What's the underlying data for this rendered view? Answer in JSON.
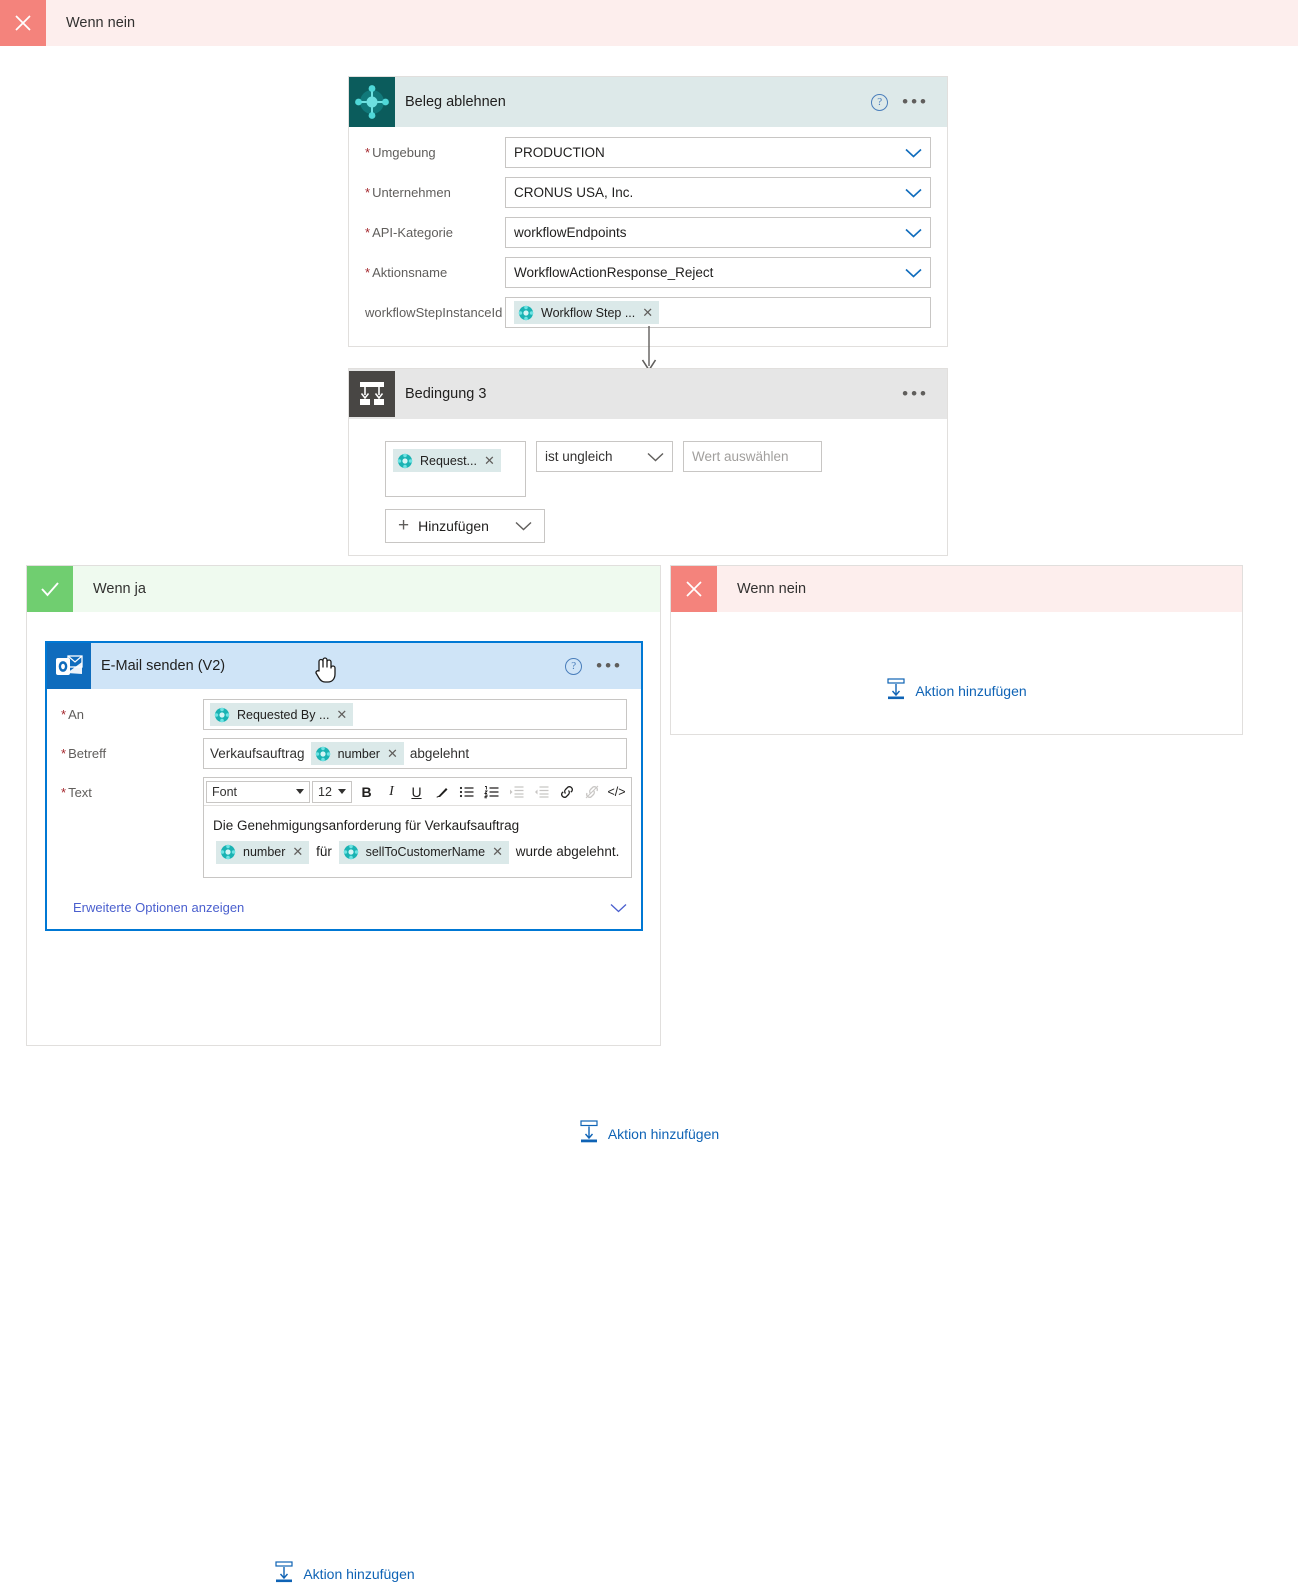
{
  "top_branch_bar": {
    "label": "Wenn nein",
    "icon": "close-x-icon",
    "glyph_bg": "#f4837c",
    "label_bg": "#fdeeed"
  },
  "reject_action_card": {
    "title": "Beleg ablehnen",
    "icon": "business-central-icon",
    "header_bg": "#dde9e9",
    "help_glyph": "?",
    "more_glyph": "•••",
    "fields": [
      {
        "label": "Umgebung",
        "required": true,
        "value": "PRODUCTION",
        "control": "dropdown"
      },
      {
        "label": "Unternehmen",
        "required": true,
        "value": "CRONUS USA, Inc.",
        "control": "dropdown"
      },
      {
        "label": "API-Kategorie",
        "required": true,
        "value": "workflowEndpoints",
        "control": "dropdown"
      },
      {
        "label": "Aktionsname",
        "required": true,
        "value": "WorkflowActionResponse_Reject",
        "control": "dropdown"
      }
    ],
    "token_field": {
      "label": "workflowStepInstanceId",
      "required": false,
      "token": {
        "text": "Workflow Step ...",
        "icon": "business-central-token-icon",
        "remove": "✕"
      }
    }
  },
  "condition_card": {
    "title": "Bedingung 3",
    "icon": "condition-branch-icon",
    "header_bg": "#e6e6e6",
    "more_glyph": "•••",
    "row": {
      "left_token": {
        "text": "Request...",
        "icon": "business-central-token-icon",
        "remove": "✕"
      },
      "operator": "ist ungleich",
      "value_placeholder": "Wert auswählen"
    },
    "add_button": {
      "label": "Hinzufügen",
      "plus": "+"
    }
  },
  "yes_branch": {
    "label": "Wenn ja",
    "icon": "checkmark-icon",
    "glyph_bg": "#70ce70",
    "label_bg": "#effaef",
    "email_card": {
      "title": "E-Mail senden (V2)",
      "icon": "outlook-icon",
      "header_bg": "#cfe4f7",
      "selected_border": "#0078d4",
      "help_glyph": "?",
      "more_glyph": "•••",
      "to": {
        "label": "An",
        "required": true,
        "token": {
          "text": "Requested By ...",
          "icon": "business-central-token-icon",
          "remove": "✕"
        }
      },
      "subject": {
        "label": "Betreff",
        "required": true,
        "prefix_text": "Verkaufsauftrag",
        "token": {
          "text": "number",
          "icon": "business-central-token-icon",
          "remove": "✕"
        },
        "suffix_text": "abgelehnt"
      },
      "body": {
        "label": "Text",
        "required": true,
        "toolbar": {
          "font_name": "Font",
          "font_size": "12",
          "bold": "B",
          "italic": "I",
          "underline": "U",
          "text_color": "highlight-pen-icon",
          "bulleted_list": "bulleted-list-icon",
          "numbered_list": "numbered-list-icon",
          "indent": "indent-icon",
          "outdent": "outdent-icon",
          "link": "link-icon",
          "unlink": "unlink-icon",
          "code_view": "</>"
        },
        "content": {
          "text_1": "Die Genehmigungsanforderung für Verkaufsauftrag",
          "token_1": {
            "text": "number",
            "icon": "business-central-token-icon",
            "remove": "✕"
          },
          "text_2": "für",
          "token_2": {
            "text": "sellToCustomerName",
            "icon": "business-central-token-icon",
            "remove": "✕"
          },
          "text_3": "wurde abgelehnt."
        }
      },
      "advanced_link": "Erweiterte Optionen anzeigen"
    },
    "add_action": {
      "label": "Aktion hinzufügen",
      "icon": "insert-step-icon"
    }
  },
  "no_branch": {
    "label": "Wenn nein",
    "icon": "close-x-icon",
    "glyph_bg": "#f4837c",
    "label_bg": "#fdeeed",
    "add_action": {
      "label": "Aktion hinzufügen",
      "icon": "insert-step-icon"
    }
  },
  "bottom_add_action": {
    "label": "Aktion hinzufügen",
    "icon": "insert-step-icon"
  },
  "cursor": {
    "icon": "pointing-hand-cursor"
  }
}
